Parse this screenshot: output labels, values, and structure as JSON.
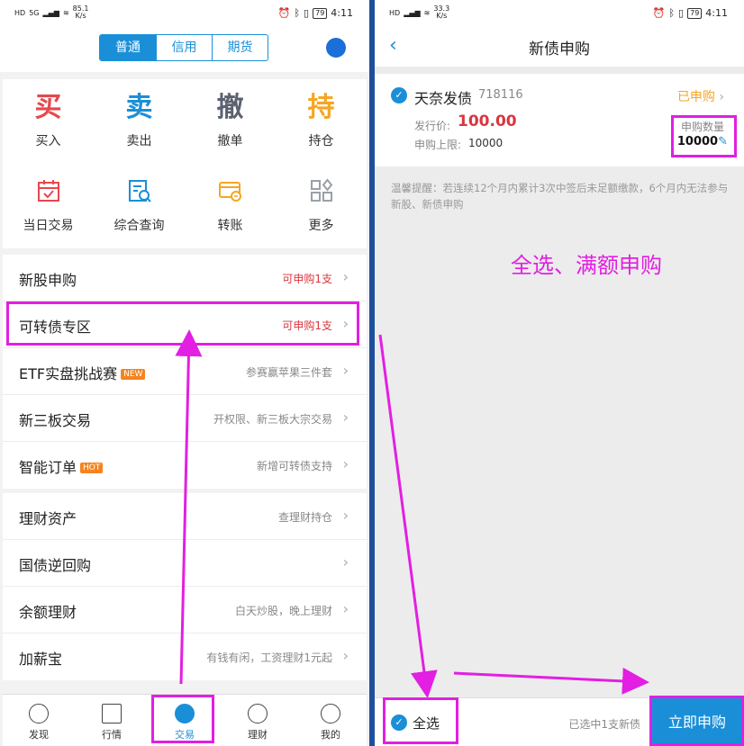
{
  "left": {
    "status": {
      "net1": "HD",
      "net2": "HD",
      "sig": "5G",
      "speed_val": "85.1",
      "speed_unit": "K/s",
      "battery": "79",
      "time": "4:11"
    },
    "segment": {
      "tabs": [
        "普通",
        "信用",
        "期货"
      ],
      "active": 0
    },
    "grid": [
      {
        "glyph": "买",
        "label": "买入",
        "color": "#e5484d"
      },
      {
        "glyph": "卖",
        "label": "卖出",
        "color": "#1a8fd8"
      },
      {
        "glyph": "撤",
        "label": "撤单",
        "color": "#5a6170"
      },
      {
        "glyph": "持",
        "label": "持仓",
        "color": "#f5a623"
      }
    ],
    "grid2": [
      {
        "icon": "calendar-icon",
        "label": "当日交易",
        "color": "#e5484d"
      },
      {
        "icon": "search-document-icon",
        "label": "综合查询",
        "color": "#1a8fd8"
      },
      {
        "icon": "transfer-card-icon",
        "label": "转账",
        "color": "#f5a623"
      },
      {
        "icon": "more-grid-icon",
        "label": "更多",
        "color": "#9aa0a6"
      }
    ],
    "list1": [
      {
        "title": "新股申购",
        "right": "可申购1支",
        "red": true
      },
      {
        "title": "可转债专区",
        "right": "可申购1支",
        "red": true
      },
      {
        "title": "ETF实盘挑战赛",
        "tag": "NEW",
        "tag_color": "#f5841f",
        "right": "参赛赢苹果三件套",
        "red": false
      },
      {
        "title": "新三板交易",
        "right": "开权限、新三板大宗交易",
        "red": false
      },
      {
        "title": "智能订单",
        "tag": "HOT",
        "tag_color": "#f5841f",
        "right": "新增可转债支持",
        "red": false
      }
    ],
    "list2": [
      {
        "title": "理财资产",
        "right": "查理财持仓",
        "red": false
      },
      {
        "title": "国债逆回购",
        "right": "",
        "red": false
      },
      {
        "title": "余额理财",
        "right": "白天炒股，晚上理财",
        "red": false
      },
      {
        "title": "加薪宝",
        "right": "有钱有闲，工资理财1元起",
        "red": false
      }
    ],
    "tabs": [
      {
        "label": "发现",
        "icon": "compass-icon"
      },
      {
        "label": "行情",
        "icon": "chart-icon"
      },
      {
        "label": "交易",
        "icon": "trade-icon",
        "active": true
      },
      {
        "label": "理财",
        "icon": "finance-icon"
      },
      {
        "label": "我的",
        "icon": "user-icon"
      }
    ]
  },
  "right": {
    "status": {
      "speed_val": "33.3",
      "speed_unit": "K/s",
      "battery": "79",
      "time": "4:11"
    },
    "title": "新债申购",
    "bond": {
      "name": "天奈发债",
      "code": "718116",
      "status": "已申购",
      "price_label": "发行价:",
      "price": "100.00",
      "limit_label": "申购上限:",
      "limit": "10000",
      "qty_label": "申购数量",
      "qty": "10000"
    },
    "tip": "温馨提醒：若连续12个月内累计3次中签后未足额缴款，6个月内无法参与新股、新债申购",
    "annotation": "全选、满额申购",
    "footer": {
      "select_all": "全选",
      "selected_info": "已选中1支新债",
      "buy": "立即申购"
    }
  }
}
